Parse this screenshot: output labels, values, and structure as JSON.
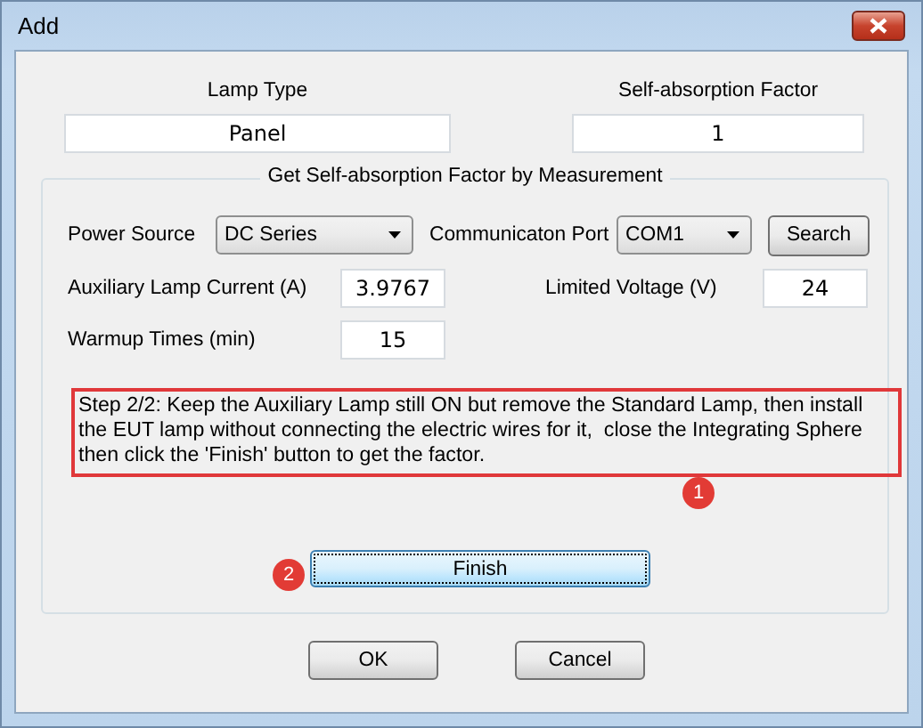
{
  "window": {
    "title": "Add"
  },
  "lamp_type": {
    "label": "Lamp Type",
    "value": "Panel"
  },
  "self_absorption_factor": {
    "label": "Self-absorption Factor",
    "value": "1"
  },
  "measurement": {
    "title": "Get Self-absorption Factor by Measurement",
    "power_source": {
      "label": "Power Source",
      "value": "DC Series"
    },
    "port": {
      "label": "Communicaton Port",
      "value": "COM1"
    },
    "search_button": "Search",
    "auxiliary_current": {
      "label": "Auxiliary Lamp Current (A)",
      "value": "3.9767"
    },
    "limited_voltage": {
      "label": "Limited Voltage (V)",
      "value": "24"
    },
    "warmup": {
      "label": "Warmup Times (min)",
      "value": "15"
    },
    "instructions": "Step 2/2: Keep the Auxiliary Lamp still ON but remove the Standard Lamp, then install the EUT lamp without connecting the electric wires for it,  close the Integrating Sphere then click the 'Finish' button to get the factor.",
    "finish_button": {
      "label": "Finish",
      "focused": true
    },
    "callouts": [
      {
        "number": "1"
      },
      {
        "number": "2"
      }
    ]
  },
  "buttons": [
    "OK",
    "Cancel"
  ]
}
